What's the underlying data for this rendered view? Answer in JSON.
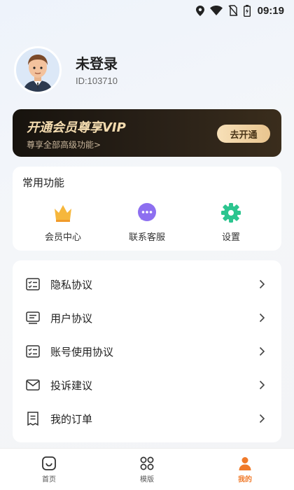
{
  "status_bar": {
    "time": "09:19",
    "icons": [
      "location-icon",
      "wifi-icon",
      "no-sim-icon",
      "battery-icon"
    ]
  },
  "profile": {
    "name": "未登录",
    "id": "ID:103710",
    "avatar_icon": "avatar-icon"
  },
  "vip": {
    "title": "开通会员尊享VIP",
    "subtitle": "尊享全部高级功能>",
    "button": "去开通"
  },
  "common": {
    "title": "常用功能",
    "items": [
      {
        "label": "会员中心",
        "icon": "crown-icon"
      },
      {
        "label": "联系客服",
        "icon": "chat-icon"
      },
      {
        "label": "设置",
        "icon": "gear-icon"
      }
    ]
  },
  "menu": {
    "items": [
      {
        "label": "隐私协议",
        "icon": "privacy-doc-icon"
      },
      {
        "label": "用户协议",
        "icon": "user-doc-icon"
      },
      {
        "label": "账号使用协议",
        "icon": "account-doc-icon"
      },
      {
        "label": "投诉建议",
        "icon": "mail-icon"
      },
      {
        "label": "我的订单",
        "icon": "order-icon"
      }
    ]
  },
  "tabbar": {
    "items": [
      {
        "label": "首页",
        "icon": "home-icon"
      },
      {
        "label": "模版",
        "icon": "grid-icon"
      },
      {
        "label": "我的",
        "icon": "person-icon",
        "active": true
      }
    ]
  },
  "colors": {
    "accent": "#f07a2a",
    "vip_gold": "#f4dcb0",
    "vip_bg": "#1f1912"
  }
}
